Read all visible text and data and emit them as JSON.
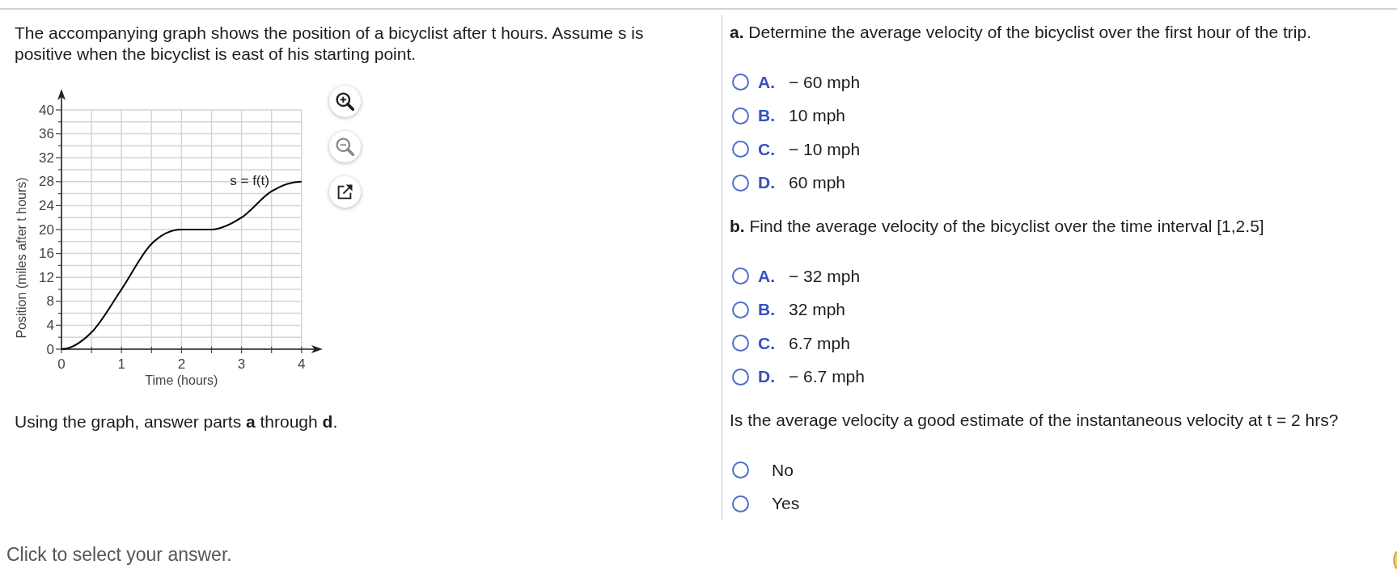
{
  "problem": {
    "text": "The accompanying graph shows the position of a bicyclist after t hours. Assume s is positive when the bicyclist is east of his starting point.",
    "chart_data": {
      "type": "line",
      "grid": true,
      "xlabel": "Time (hours)",
      "ylabel": "Position (miles after t hours)",
      "x": [
        0,
        0.5,
        1,
        1.5,
        2,
        2.5,
        3,
        3.5,
        4
      ],
      "series": [
        {
          "name": "s = f(t)",
          "color": "#000000",
          "values": [
            0,
            2.8,
            10,
            17.6,
            20,
            20,
            22,
            26.4,
            28
          ]
        }
      ],
      "xlim": [
        0,
        4
      ],
      "ylim": [
        0,
        40
      ],
      "xticks": [
        0,
        1,
        2,
        3,
        4
      ],
      "yticks": [
        0,
        4,
        8,
        12,
        16,
        20,
        24,
        28,
        32,
        36,
        40
      ]
    },
    "graph_tools": [
      {
        "kind": "zoom_in",
        "disabled": false
      },
      {
        "kind": "zoom_out",
        "disabled": true
      },
      {
        "kind": "popout",
        "disabled": false
      }
    ],
    "instruction": "Using the graph, answer parts **a** through **d**."
  },
  "parts": [
    {
      "prompt": "**a.** Determine the average velocity of the bicyclist over the first hour of the trip.",
      "options": [
        {
          "letter": "A.",
          "text": "− 60 mph",
          "selected": false
        },
        {
          "letter": "B.",
          "text": "10 mph",
          "selected": false
        },
        {
          "letter": "C.",
          "text": "− 10 mph",
          "selected": false
        },
        {
          "letter": "D.",
          "text": "60 mph",
          "selected": false
        }
      ]
    },
    {
      "prompt": "**b.** Find the average velocity of the bicyclist over the time interval [1,2.5]",
      "options": [
        {
          "letter": "A.",
          "text": "− 32 mph",
          "selected": false
        },
        {
          "letter": "B.",
          "text": "32 mph",
          "selected": false
        },
        {
          "letter": "C.",
          "text": "6.7 mph",
          "selected": false
        },
        {
          "letter": "D.",
          "text": "− 6.7 mph",
          "selected": false
        }
      ]
    },
    {
      "prompt": "Is the average velocity a good estimate of the instantaneous velocity at t = 2 hrs?",
      "options": [
        {
          "text": "No",
          "selected": false
        },
        {
          "text": "Yes",
          "selected": false
        }
      ]
    }
  ],
  "status_text": "Click to select your answer."
}
